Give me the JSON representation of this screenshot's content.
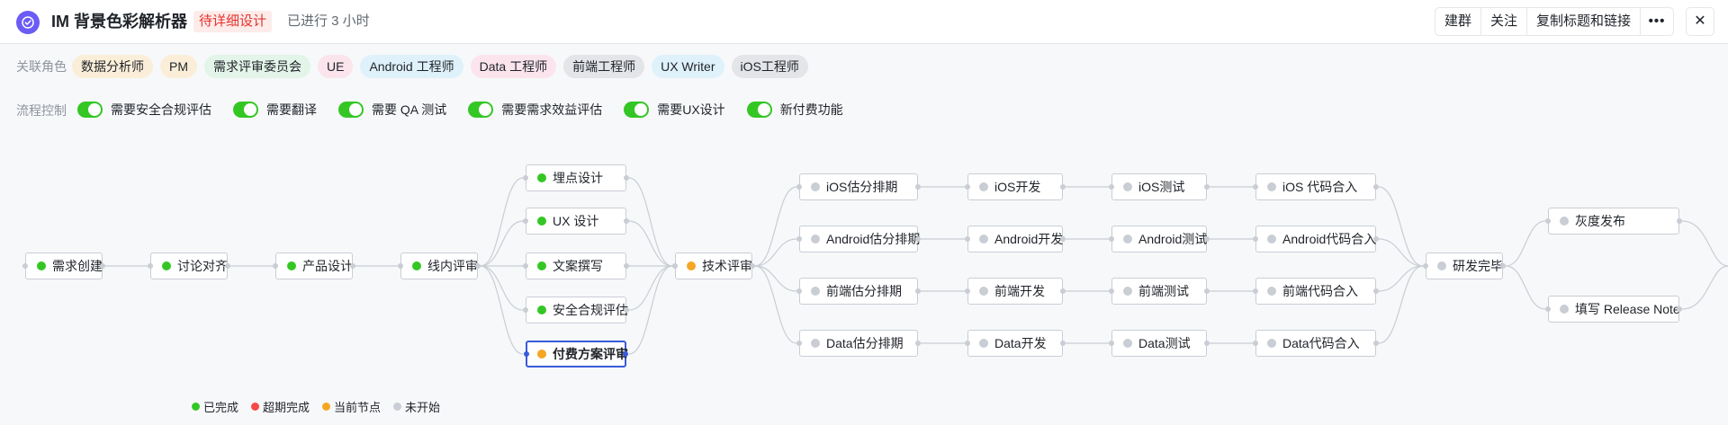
{
  "header": {
    "title": "IM 背景色彩解析器",
    "status": "待详细设计",
    "elapsed": "已进行 3 小时",
    "buttons": {
      "group": "建群",
      "follow": "关注",
      "copy": "复制标题和链接",
      "more": "•••",
      "close": "✕"
    }
  },
  "roles": {
    "label": "关联角色",
    "items": [
      {
        "label": "数据分析师",
        "color": "#fbeed8"
      },
      {
        "label": "PM",
        "color": "#fbeed8"
      },
      {
        "label": "需求评审委员会",
        "color": "#e3f4e8"
      },
      {
        "label": "UE",
        "color": "#fbe4ec"
      },
      {
        "label": "Android 工程师",
        "color": "#dff1fb"
      },
      {
        "label": "Data 工程师",
        "color": "#fbe4ec"
      },
      {
        "label": "前端工程师",
        "color": "#e3e5e8"
      },
      {
        "label": "UX Writer",
        "color": "#dff1fb"
      },
      {
        "label": "iOS工程师",
        "color": "#e3e5e8"
      }
    ]
  },
  "flow_control": {
    "label": "流程控制",
    "toggles": [
      {
        "label": "需要安全合规评估",
        "on": true
      },
      {
        "label": "需要翻译",
        "on": true
      },
      {
        "label": "需要 QA 测试",
        "on": true
      },
      {
        "label": "需要需求效益评估",
        "on": true
      },
      {
        "label": "需要UX设计",
        "on": true
      },
      {
        "label": "新付费功能",
        "on": true
      }
    ]
  },
  "nodes": {
    "req_create": {
      "label": "需求创建",
      "state": "done"
    },
    "discuss": {
      "label": "讨论对齐",
      "state": "done"
    },
    "product_design": {
      "label": "产品设计",
      "state": "done"
    },
    "online_review": {
      "label": "线内评审",
      "state": "done"
    },
    "tracking": {
      "label": "埋点设计",
      "state": "done"
    },
    "ux": {
      "label": "UX 设计",
      "state": "done"
    },
    "copy": {
      "label": "文案撰写",
      "state": "done"
    },
    "security": {
      "label": "安全合规评估",
      "state": "done"
    },
    "pay_review": {
      "label": "付费方案评审",
      "state": "current"
    },
    "tech_review": {
      "label": "技术评审",
      "state": "current"
    },
    "ios_plan": {
      "label": "iOS估分排期",
      "state": "pending"
    },
    "ios_dev": {
      "label": "iOS开发",
      "state": "pending"
    },
    "ios_test": {
      "label": "iOS测试",
      "state": "pending"
    },
    "ios_merge": {
      "label": "iOS 代码合入",
      "state": "pending"
    },
    "android_plan": {
      "label": "Android估分排期",
      "state": "pending"
    },
    "android_dev": {
      "label": "Android开发",
      "state": "pending"
    },
    "android_test": {
      "label": "Android测试",
      "state": "pending"
    },
    "android_merge": {
      "label": "Android代码合入",
      "state": "pending"
    },
    "fe_plan": {
      "label": "前端估分排期",
      "state": "pending"
    },
    "fe_dev": {
      "label": "前端开发",
      "state": "pending"
    },
    "fe_test": {
      "label": "前端测试",
      "state": "pending"
    },
    "fe_merge": {
      "label": "前端代码合入",
      "state": "pending"
    },
    "data_plan": {
      "label": "Data估分排期",
      "state": "pending"
    },
    "data_dev": {
      "label": "Data开发",
      "state": "pending"
    },
    "data_test": {
      "label": "Data测试",
      "state": "pending"
    },
    "data_merge": {
      "label": "Data代码合入",
      "state": "pending"
    },
    "dev_done": {
      "label": "研发完毕",
      "state": "pending"
    },
    "gray": {
      "label": "灰度发布",
      "state": "pending"
    },
    "release_note": {
      "label": "填写 Release Note",
      "state": "pending"
    }
  },
  "legend": [
    {
      "label": "已完成",
      "state": "done"
    },
    {
      "label": "超期完成",
      "state": "overdue"
    },
    {
      "label": "当前节点",
      "state": "current"
    },
    {
      "label": "未开始",
      "state": "pending"
    }
  ]
}
